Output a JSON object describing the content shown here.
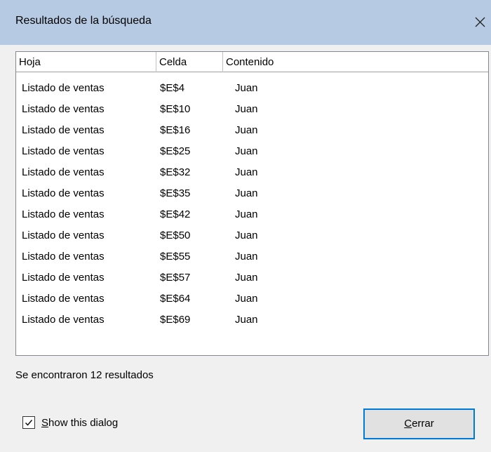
{
  "window": {
    "title": "Resultados de la búsqueda",
    "close_icon": "close-icon"
  },
  "table": {
    "columns": [
      "Hoja",
      "Celda",
      "Contenido"
    ],
    "rows": [
      [
        "Listado de ventas",
        "$E$4",
        "Juan"
      ],
      [
        "Listado de ventas",
        "$E$10",
        "Juan"
      ],
      [
        "Listado de ventas",
        "$E$16",
        "Juan"
      ],
      [
        "Listado de ventas",
        "$E$25",
        "Juan"
      ],
      [
        "Listado de ventas",
        "$E$32",
        "Juan"
      ],
      [
        "Listado de ventas",
        "$E$35",
        "Juan"
      ],
      [
        "Listado de ventas",
        "$E$42",
        "Juan"
      ],
      [
        "Listado de ventas",
        "$E$50",
        "Juan"
      ],
      [
        "Listado de ventas",
        "$E$55",
        "Juan"
      ],
      [
        "Listado de ventas",
        "$E$57",
        "Juan"
      ],
      [
        "Listado de ventas",
        "$E$64",
        "Juan"
      ],
      [
        "Listado de ventas",
        "$E$69",
        "Juan"
      ]
    ]
  },
  "status": {
    "text": "Se encontraron 12 resultados"
  },
  "options": {
    "show_dialog_mnemonic": "S",
    "show_dialog_rest": "how this dialog",
    "show_dialog_checked": true
  },
  "buttons": {
    "close_mnemonic": "C",
    "close_rest": "errar"
  },
  "colors": {
    "titlebar": "#b6cbe3",
    "background": "#f0f0f0",
    "button_focus": "#0078d7"
  }
}
